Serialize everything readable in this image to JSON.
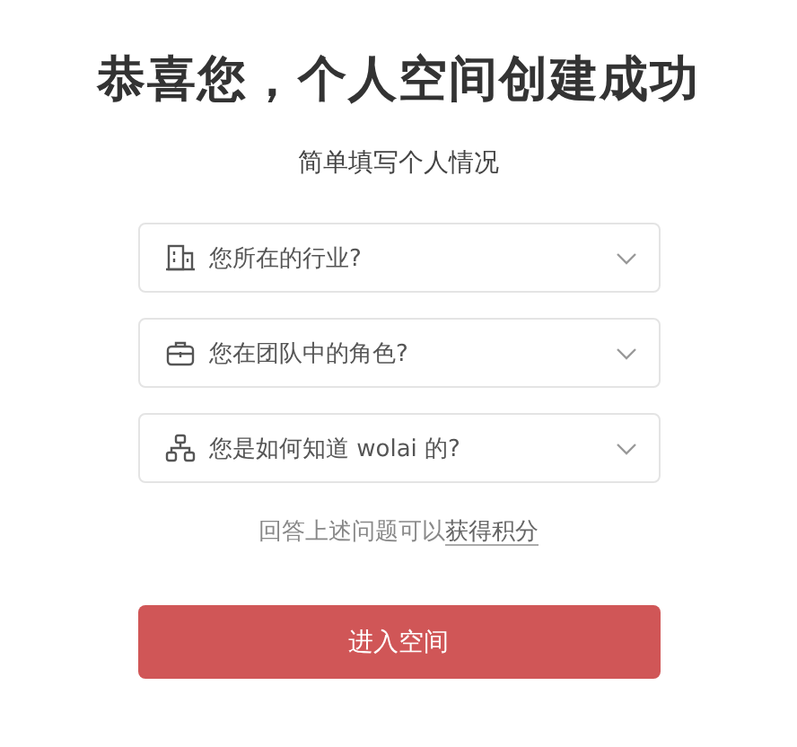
{
  "title": "恭喜您，个人空间创建成功",
  "subtitle": "简单填写个人情况",
  "questions": [
    {
      "kind": "building",
      "placeholder": "您所在的行业?"
    },
    {
      "kind": "briefcase",
      "placeholder": "您在团队中的角色?"
    },
    {
      "kind": "hierarchy",
      "placeholder": "您是如何知道 wolai 的?"
    }
  ],
  "hint": {
    "text": "回答上述问题可以",
    "link": "获得积分"
  },
  "button": "进入空间"
}
